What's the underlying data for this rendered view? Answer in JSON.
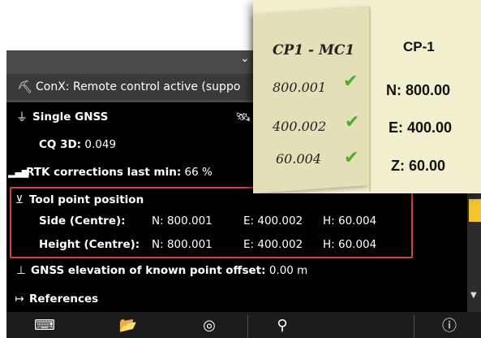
{
  "conx": {
    "text": "ConX: Remote control active (suppo"
  },
  "rows": {
    "single_gnss": "Single GNSS",
    "cq3d_label": "CQ 3D:",
    "cq3d_value": "0.049",
    "rtk_label": "RTK corrections last min:",
    "rtk_value": "66 %",
    "tool_point": "Tool point position",
    "side_label": "Side (Centre):",
    "side_n": "N: 800.001",
    "side_e": "E: 400.002",
    "side_h": "H: 60.004",
    "height_label": "Height (Centre):",
    "height_n": "N: 800.001",
    "height_e": "E: 400.002",
    "height_h": "H: 60.004",
    "gnss_elev_label": "GNSS elevation of known point offset:",
    "gnss_elev_value": "0.00 m",
    "references": "References"
  },
  "note": {
    "left_title": "CP1 - MC1",
    "left_values": [
      "800.001",
      "400.002",
      "60.004"
    ],
    "right_title": "CP-1",
    "right_values": [
      "N: 800.00",
      "E: 400.00",
      "Z: 60.00"
    ]
  },
  "colors": {
    "highlight": "#d9413c",
    "scroll_thumb": "#f4c430",
    "check": "#4caf2a"
  }
}
